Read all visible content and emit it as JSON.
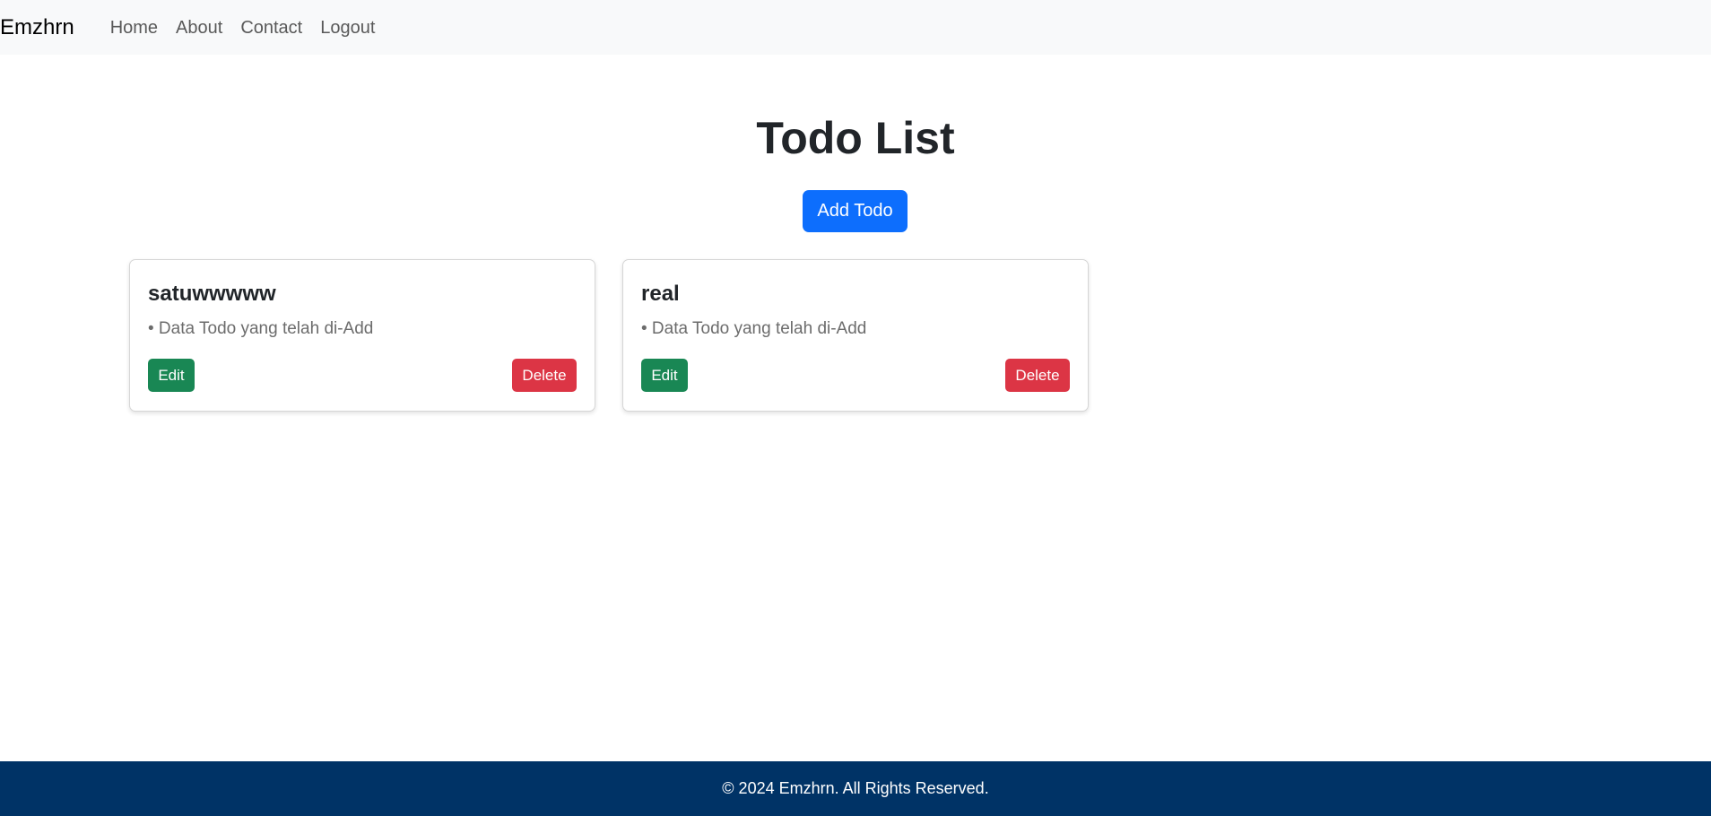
{
  "navbar": {
    "brand": "Emzhrn",
    "links": [
      {
        "label": "Home"
      },
      {
        "label": "About"
      },
      {
        "label": "Contact"
      },
      {
        "label": "Logout"
      }
    ]
  },
  "main": {
    "title": "Todo List",
    "add_button_label": "Add Todo",
    "todos": [
      {
        "title": "satuwwwww",
        "text": "• Data Todo yang telah di-Add",
        "edit_label": "Edit",
        "delete_label": "Delete"
      },
      {
        "title": "real",
        "text": "• Data Todo yang telah di-Add",
        "edit_label": "Edit",
        "delete_label": "Delete"
      }
    ]
  },
  "footer": {
    "text": "© 2024 Emzhrn. All Rights Reserved."
  },
  "colors": {
    "primary": "#0d6efd",
    "success": "#198754",
    "danger": "#dc3545",
    "footer_bg": "#003366",
    "navbar_bg": "#f8f9fa"
  }
}
